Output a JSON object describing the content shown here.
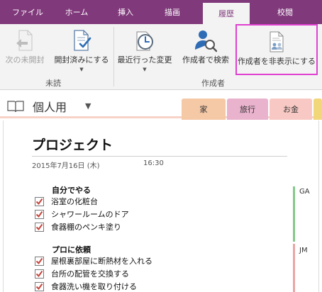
{
  "ribbon": {
    "tabs": [
      {
        "label": "ファイル",
        "active": false
      },
      {
        "label": "ホーム",
        "active": false
      },
      {
        "label": "挿入",
        "active": false
      },
      {
        "label": "描画",
        "active": false
      },
      {
        "label": "履歴",
        "active": true
      },
      {
        "label": "校閲",
        "active": false
      }
    ],
    "groups": {
      "unread": {
        "label": "未読",
        "next_unread": {
          "label": "次の未開封",
          "icon": "arrow-left-icon",
          "enabled": false
        },
        "mark_read": {
          "label": "開封済みにする",
          "icon": "document-check-icon"
        }
      },
      "authors": {
        "label": "作成者",
        "recent_edits": {
          "label": "最近行った変更",
          "icon": "clock-icon"
        },
        "find_by_author": {
          "label": "作成者で検索",
          "icon": "person-search-icon"
        },
        "hide_authors": {
          "label": "作成者を非表示にする",
          "icon": "hide-authors-icon",
          "highlighted": true
        }
      }
    }
  },
  "notebook": {
    "name": "個人用",
    "icon": "notebook-icon",
    "sections": [
      {
        "label": "家",
        "color": "#f5c8a6",
        "active": true
      },
      {
        "label": "旅行",
        "color": "#e9b2cd",
        "active": false
      },
      {
        "label": "お金",
        "color": "#f8c9c4",
        "active": false
      }
    ]
  },
  "page": {
    "title": "プロジェクト",
    "date": "2015年7月16日 (木)",
    "time": "16:30",
    "groups": [
      {
        "heading": "自分でやる",
        "author": "GA",
        "author_color": "#86c98a",
        "items": [
          "浴室の化粧台",
          "シャワールームのドア",
          "食器棚のペンキ塗り"
        ]
      },
      {
        "heading": "プロに依頼",
        "author": "JM",
        "author_color": "#e9a6a6",
        "items": [
          "屋根裏部屋に断熱材を入れる",
          "台所の配管を交換する",
          "食器洗い機を取り付ける"
        ]
      }
    ]
  },
  "colors": {
    "accent": "#80397b",
    "check": "#c5463d",
    "highlight_box": "#e040d0"
  }
}
